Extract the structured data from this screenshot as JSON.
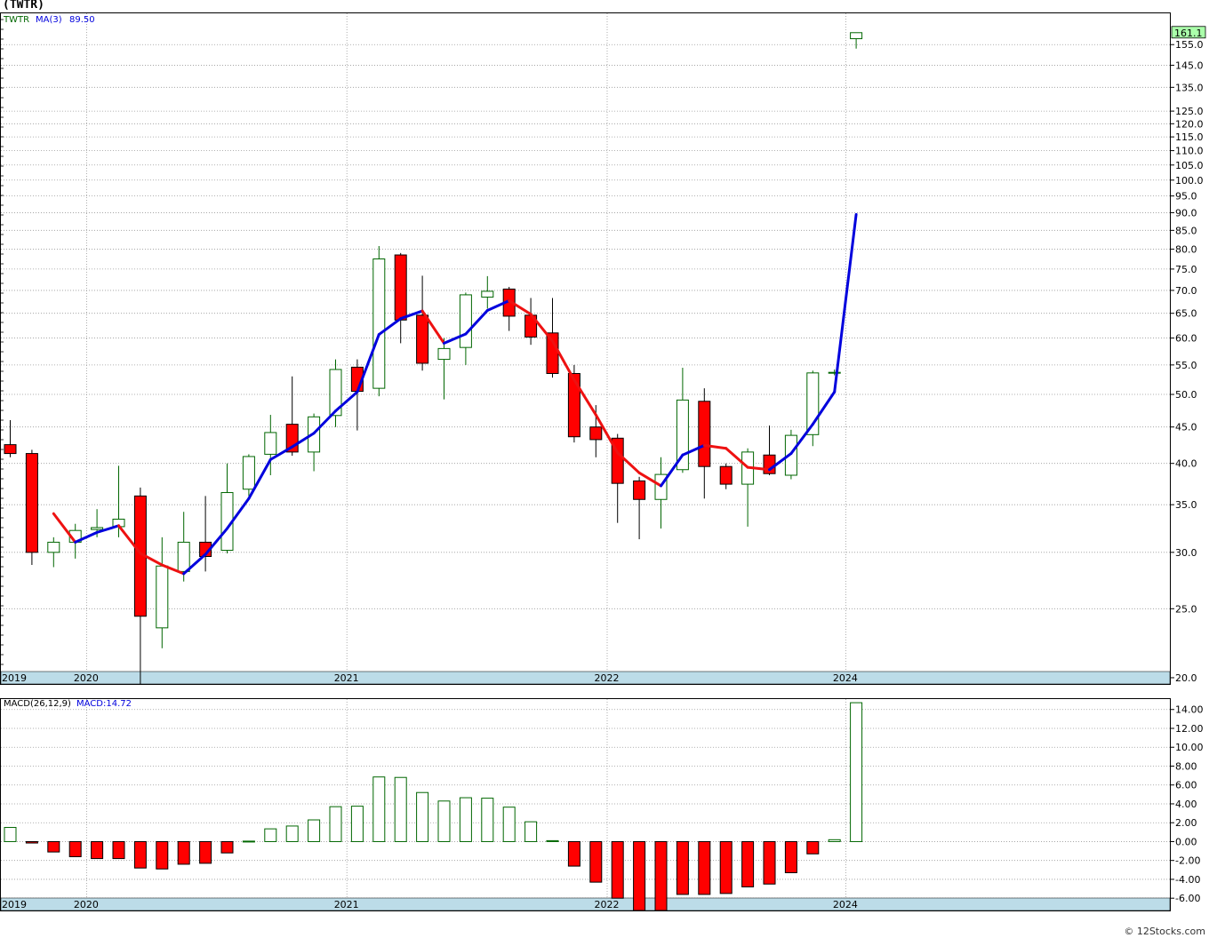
{
  "title": "(TWTR)",
  "credit": "© 12Stocks.com",
  "colors": {
    "up": "#006600",
    "down": "#ff0000",
    "ma_up": "#0000dd",
    "ma_down": "#ee1111",
    "axis_band": "#bcdce8",
    "last_price_bg": "#aaffaa"
  },
  "chart_data": [
    {
      "type": "candlestick",
      "legend": {
        "ticker": "TWTR",
        "ma_label": "MA(3)",
        "ma_value": "89.50"
      },
      "last_price_label": "161.1",
      "y_scale": "log",
      "ylim": [
        19.6,
        172
      ],
      "y_ticks": [
        "20.0",
        "25.0",
        "30.0",
        "35.0",
        "40.0",
        "45.0",
        "50.0",
        "55.0",
        "60.0",
        "65.0",
        "70.0",
        "75.0",
        "80.0",
        "85.0",
        "90.0",
        "95.0",
        "100.0",
        "105.0",
        "110.0",
        "115.0",
        "120.0",
        "125.0",
        "135.0",
        "145.0",
        "155.0"
      ],
      "x_labels": [
        "2019",
        "2020",
        "2021",
        "2022",
        "2024"
      ],
      "candles": [
        {
          "o": 42.5,
          "h": 46.0,
          "l": 40.8,
          "c": 41.3
        },
        {
          "o": 41.3,
          "h": 41.8,
          "l": 28.8,
          "c": 30.0
        },
        {
          "o": 30.0,
          "h": 31.5,
          "l": 28.6,
          "c": 31.0
        },
        {
          "o": 31.0,
          "h": 32.9,
          "l": 29.4,
          "c": 32.2
        },
        {
          "o": 32.3,
          "h": 34.5,
          "l": 31.5,
          "c": 32.5
        },
        {
          "o": 32.6,
          "h": 39.7,
          "l": 31.5,
          "c": 33.4
        },
        {
          "o": 36.0,
          "h": 37.0,
          "l": 19.6,
          "c": 24.4
        },
        {
          "o": 23.5,
          "h": 31.5,
          "l": 22.0,
          "c": 28.7
        },
        {
          "o": 28.2,
          "h": 34.2,
          "l": 27.3,
          "c": 31.0
        },
        {
          "o": 31.0,
          "h": 36.0,
          "l": 28.2,
          "c": 29.6
        },
        {
          "o": 30.2,
          "h": 40.0,
          "l": 29.9,
          "c": 36.4
        },
        {
          "o": 36.8,
          "h": 41.2,
          "l": 36.0,
          "c": 40.9
        },
        {
          "o": 41.2,
          "h": 46.8,
          "l": 38.5,
          "c": 44.2
        },
        {
          "o": 45.4,
          "h": 53.0,
          "l": 41.0,
          "c": 41.5
        },
        {
          "o": 41.5,
          "h": 47.0,
          "l": 39.0,
          "c": 46.5
        },
        {
          "o": 46.7,
          "h": 56.0,
          "l": 45.0,
          "c": 54.2
        },
        {
          "o": 54.6,
          "h": 56.0,
          "l": 44.5,
          "c": 50.5
        },
        {
          "o": 51.0,
          "h": 80.8,
          "l": 49.7,
          "c": 77.5
        },
        {
          "o": 78.5,
          "h": 79.0,
          "l": 59.0,
          "c": 63.6
        },
        {
          "o": 64.6,
          "h": 73.4,
          "l": 54.0,
          "c": 55.3
        },
        {
          "o": 56.0,
          "h": 60.0,
          "l": 49.2,
          "c": 58.0
        },
        {
          "o": 58.2,
          "h": 69.5,
          "l": 55.0,
          "c": 69.0
        },
        {
          "o": 68.5,
          "h": 73.3,
          "l": 66.0,
          "c": 69.8
        },
        {
          "o": 70.3,
          "h": 70.8,
          "l": 61.4,
          "c": 64.4
        },
        {
          "o": 64.6,
          "h": 68.3,
          "l": 58.7,
          "c": 60.2
        },
        {
          "o": 61.0,
          "h": 68.3,
          "l": 52.8,
          "c": 53.5
        },
        {
          "o": 53.5,
          "h": 55.0,
          "l": 42.8,
          "c": 43.6
        },
        {
          "o": 45.0,
          "h": 48.3,
          "l": 40.8,
          "c": 43.2
        },
        {
          "o": 43.4,
          "h": 44.0,
          "l": 33.0,
          "c": 37.5
        },
        {
          "o": 37.8,
          "h": 38.3,
          "l": 31.3,
          "c": 35.6
        },
        {
          "o": 35.6,
          "h": 40.8,
          "l": 32.4,
          "c": 38.6
        },
        {
          "o": 39.2,
          "h": 54.5,
          "l": 38.8,
          "c": 49.1
        },
        {
          "o": 48.9,
          "h": 51.0,
          "l": 35.7,
          "c": 39.6
        },
        {
          "o": 39.6,
          "h": 40.0,
          "l": 36.8,
          "c": 37.4
        },
        {
          "o": 37.4,
          "h": 42.0,
          "l": 32.6,
          "c": 41.5
        },
        {
          "o": 41.1,
          "h": 45.2,
          "l": 38.5,
          "c": 38.7
        },
        {
          "o": 38.5,
          "h": 44.6,
          "l": 38.0,
          "c": 43.8
        },
        {
          "o": 43.9,
          "h": 54.0,
          "l": 42.3,
          "c": 53.6
        },
        {
          "o": 53.7,
          "h": 54.2,
          "l": 53.2,
          "c": 53.7
        },
        {
          "o": 158.0,
          "h": 161.1,
          "l": 153.0,
          "c": 161.1
        }
      ],
      "ma": [
        null,
        null,
        34.0,
        31.0,
        32.0,
        32.7,
        29.9,
        28.8,
        28.0,
        29.8,
        32.4,
        35.7,
        40.5,
        42.2,
        44.1,
        47.4,
        50.4,
        60.7,
        63.9,
        65.5,
        59.0,
        60.8,
        65.6,
        67.7,
        64.8,
        59.4,
        52.4,
        46.8,
        41.4,
        38.8,
        37.2,
        41.1,
        42.4,
        42.0,
        39.5,
        39.2,
        41.3,
        45.4,
        50.4,
        89.5
      ]
    },
    {
      "type": "bar",
      "legend": {
        "name": "MACD(26,12,9)",
        "value_label": "MACD:14.72"
      },
      "ylim": [
        -7.3,
        15.2
      ],
      "y_ticks": [
        "-6.00",
        "-4.00",
        "-2.00",
        "0.00",
        "2.00",
        "4.00",
        "6.00",
        "8.00",
        "10.00",
        "12.00",
        "14.00"
      ],
      "x_labels": [
        "2019",
        "2020",
        "2021",
        "2022",
        "2024"
      ],
      "values": [
        1.5,
        -0.15,
        -1.1,
        -1.6,
        -1.8,
        -1.8,
        -2.8,
        -2.9,
        -2.4,
        -2.3,
        -1.2,
        0.05,
        1.35,
        1.65,
        2.3,
        3.7,
        3.75,
        6.85,
        6.8,
        5.2,
        4.3,
        4.65,
        4.6,
        3.65,
        2.1,
        0.1,
        -2.6,
        -4.3,
        -6.0,
        -7.3,
        -7.3,
        -5.6,
        -5.6,
        -5.5,
        -4.8,
        -4.5,
        -3.3,
        -1.3,
        0.2,
        14.72
      ]
    }
  ]
}
